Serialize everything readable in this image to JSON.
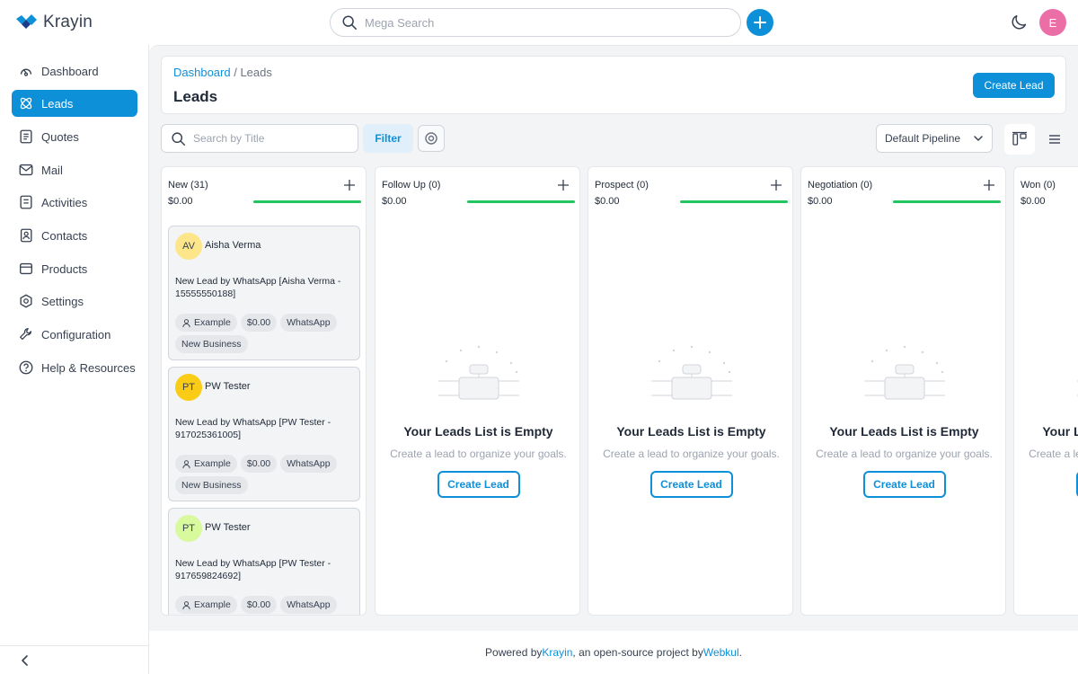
{
  "app": {
    "logo_text": "Krayin",
    "avatar_initial": "E"
  },
  "search": {
    "placeholder": "Mega Search"
  },
  "sidebar": {
    "items": [
      {
        "label": "Dashboard",
        "icon": "dashboard-icon"
      },
      {
        "label": "Leads",
        "icon": "leads-icon",
        "active": true
      },
      {
        "label": "Quotes",
        "icon": "quotes-icon"
      },
      {
        "label": "Mail",
        "icon": "mail-icon"
      },
      {
        "label": "Activities",
        "icon": "activities-icon"
      },
      {
        "label": "Contacts",
        "icon": "contacts-icon"
      },
      {
        "label": "Products",
        "icon": "products-icon"
      },
      {
        "label": "Settings",
        "icon": "settings-icon"
      },
      {
        "label": "Configuration",
        "icon": "configuration-icon"
      },
      {
        "label": "Help & Resources",
        "icon": "help-icon"
      }
    ]
  },
  "header": {
    "breadcrumb_link": "Dashboard",
    "breadcrumb_sep": " / ",
    "breadcrumb_current": "Leads",
    "title": "Leads",
    "create_button": "Create Lead"
  },
  "toolbar": {
    "search_placeholder": "Search by Title",
    "filter_label": "Filter",
    "pipeline": "Default Pipeline"
  },
  "columns": [
    {
      "title": "New (31)",
      "amount": "$0.00"
    },
    {
      "title": "Follow Up (0)",
      "amount": "$0.00"
    },
    {
      "title": "Prospect (0)",
      "amount": "$0.00"
    },
    {
      "title": "Negotiation (0)",
      "amount": "$0.00"
    },
    {
      "title": "Won (0)",
      "amount": "$0.00"
    }
  ],
  "leads": [
    {
      "initials": "AV",
      "avatar_color": "#fde68a",
      "name": "Aisha Verma",
      "title": "New Lead by WhatsApp [Aisha Verma - 15555550188]",
      "tags": [
        "Example",
        "$0.00",
        "WhatsApp",
        "New Business"
      ]
    },
    {
      "initials": "PT",
      "avatar_color": "#facc15",
      "name": "PW Tester",
      "title": "New Lead by WhatsApp [PW Tester - 917025361005]",
      "tags": [
        "Example",
        "$0.00",
        "WhatsApp",
        "New Business"
      ]
    },
    {
      "initials": "PT",
      "avatar_color": "#d9f99d",
      "name": "PW Tester",
      "title": "New Lead by WhatsApp [PW Tester - 917659824692]",
      "tags": [
        "Example",
        "$0.00",
        "WhatsApp"
      ]
    }
  ],
  "empty_state": {
    "title": "Your Leads List is Empty",
    "subtitle": "Create a lead to organize your goals.",
    "button": "Create Lead"
  },
  "footer": {
    "prefix": "Powered by ",
    "krayin": "Krayin",
    "middle": ", an open-source project by ",
    "webkul": "Webkul",
    "suffix": "."
  },
  "colors": {
    "primary": "#0e90d9",
    "progress": "#22c55e"
  }
}
